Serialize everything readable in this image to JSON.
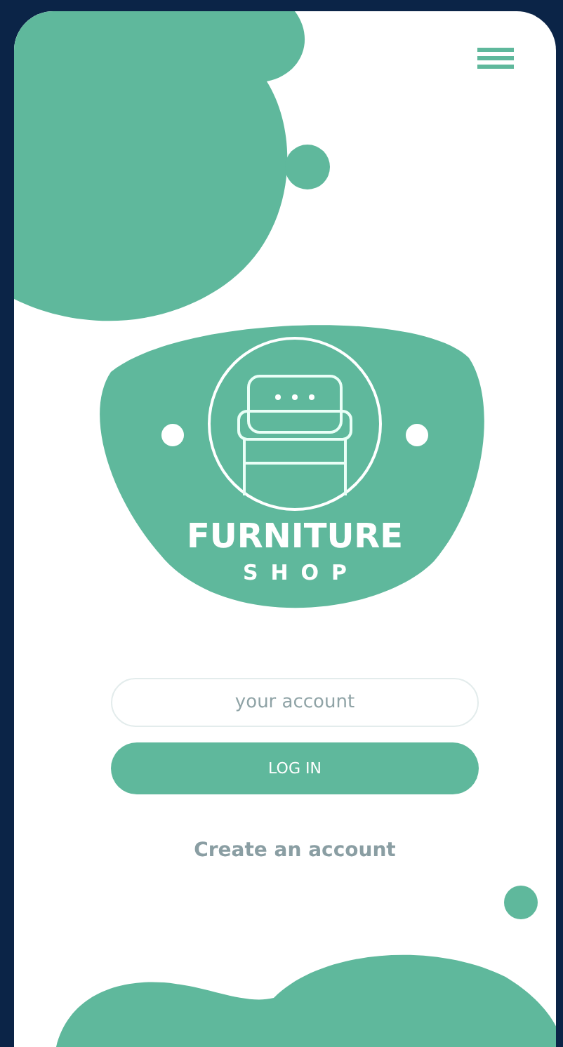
{
  "logo": {
    "title": "FURNITURE",
    "subtitle": "SHOP"
  },
  "login": {
    "account_field": {
      "placeholder": "your account"
    },
    "button": "LOG IN",
    "link": "Create an account"
  }
}
